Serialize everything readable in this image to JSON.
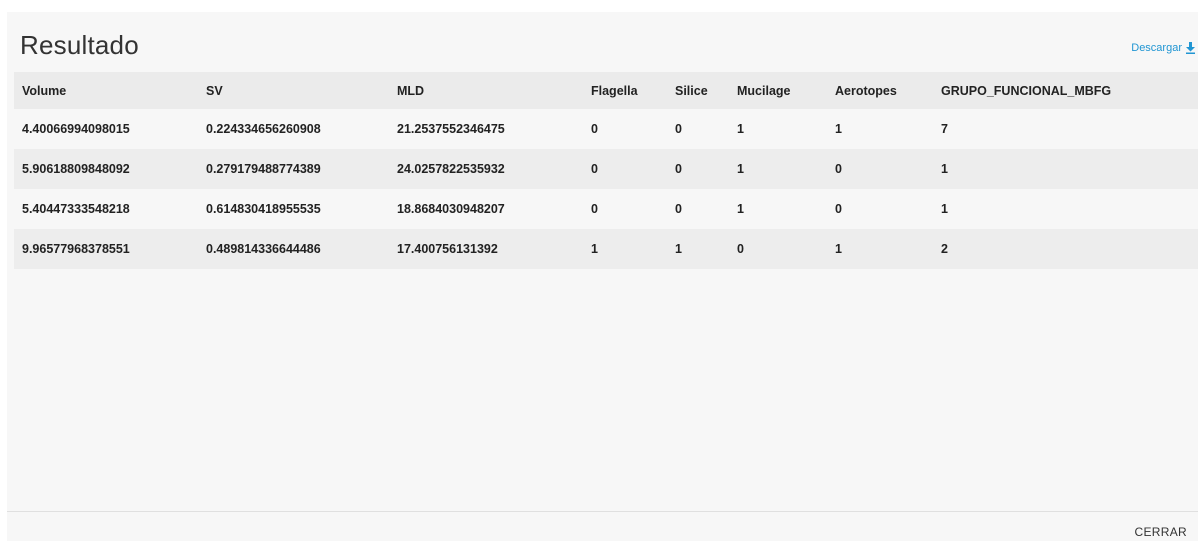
{
  "dialog": {
    "title": "Resultado",
    "download_label": "Descargar",
    "download_icon": "download-icon",
    "close_label": "CERRAR",
    "accent_color": "#2196d3"
  },
  "table": {
    "columns": [
      "Volume",
      "SV",
      "MLD",
      "Flagella",
      "Silice",
      "Mucilage",
      "Aerotopes",
      "GRUPO_FUNCIONAL_MBFG"
    ],
    "rows": [
      [
        "4.40066994098015",
        "0.224334656260908",
        "21.2537552346475",
        "0",
        "0",
        "1",
        "1",
        "7"
      ],
      [
        "5.90618809848092",
        "0.279179488774389",
        "24.0257822535932",
        "0",
        "0",
        "1",
        "0",
        "1"
      ],
      [
        "5.40447333548218",
        "0.614830418955535",
        "18.8684030948207",
        "0",
        "0",
        "1",
        "0",
        "1"
      ],
      [
        "9.96577968378551",
        "0.489814336644486",
        "17.400756131392",
        "1",
        "1",
        "0",
        "1",
        "2"
      ]
    ]
  }
}
